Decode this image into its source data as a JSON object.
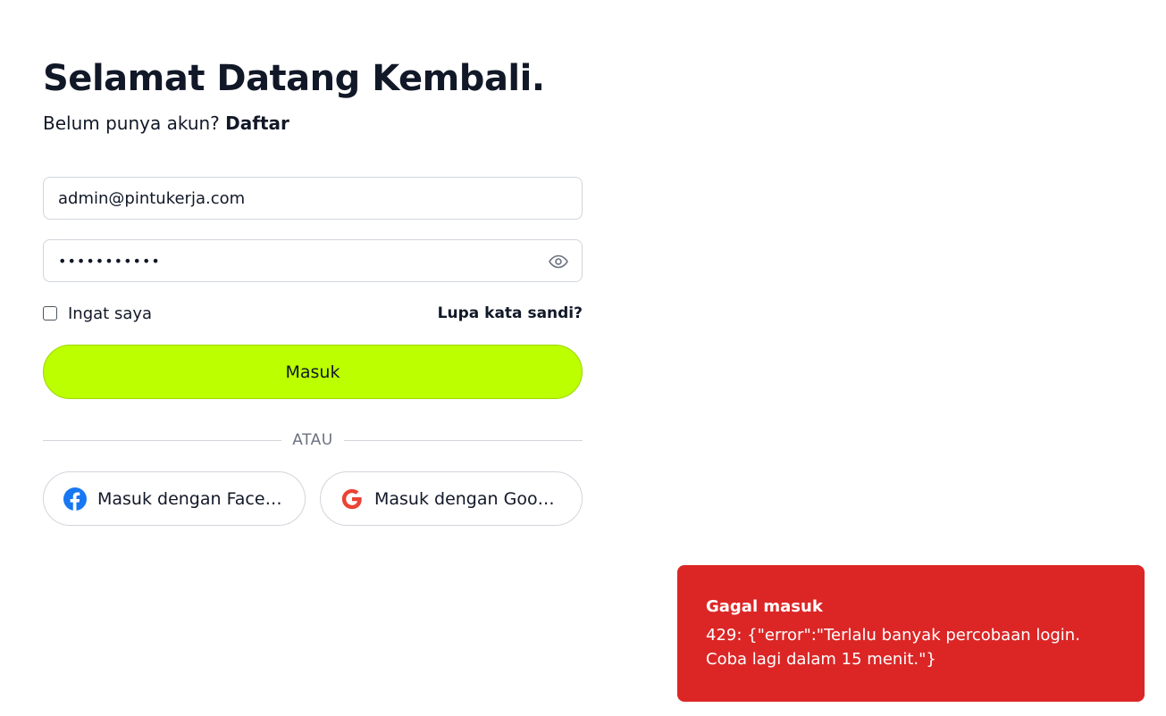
{
  "header": {
    "title": "Selamat Datang Kembali.",
    "subtitle_text": "Belum punya akun?",
    "signup_link": "Daftar"
  },
  "form": {
    "email_value": "admin@pintukerja.com",
    "password_masked": "•••••••••••",
    "remember_label": "Ingat saya",
    "remember_checked": false,
    "forgot_label": "Lupa kata sandi?",
    "submit_label": "Masuk",
    "divider_label": "ATAU"
  },
  "social": {
    "facebook_label": "Masuk dengan Facebook",
    "google_label": "Masuk dengan Google"
  },
  "toast": {
    "title": "Gagal masuk",
    "message": "429: {\"error\":\"Terlalu banyak percobaan login. Coba lagi dalam 15 menit.\"}"
  },
  "colors": {
    "primary_button": "#bbff00",
    "toast_bg": "#dc2626",
    "facebook": "#1877f2",
    "google": "#ea4335"
  },
  "icons": {
    "password_toggle": "eye-icon",
    "facebook": "facebook-icon",
    "google": "google-icon"
  }
}
